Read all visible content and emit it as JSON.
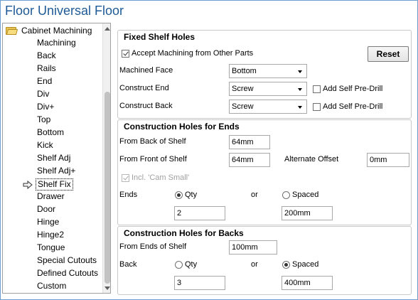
{
  "window": {
    "title": "Floor Universal Floor"
  },
  "tree": {
    "root_label": "Cabinet Machining",
    "items": [
      "Machining",
      "Back",
      "Rails",
      "End",
      "Div",
      "Div+",
      "Top",
      "Bottom",
      "Kick",
      "Shelf Adj",
      "Shelf Adj+",
      "Shelf Fix",
      "Drawer",
      "Door",
      "Hinge",
      "Hinge2",
      "Tongue",
      "Special Cutouts",
      "Defined Cutouts",
      "Custom"
    ],
    "selected": "Shelf Fix"
  },
  "fixed_shelf_holes": {
    "title": "Fixed Shelf Holes",
    "accept_machining_label": "Accept Machining from Other Parts",
    "accept_machining_checked": true,
    "reset_label": "Reset",
    "machined_face_label": "Machined Face",
    "machined_face_value": "Bottom",
    "construct_end_label": "Construct End",
    "construct_end_value": "Screw",
    "construct_back_label": "Construct Back",
    "construct_back_value": "Screw",
    "add_self_predrill_label": "Add Self Pre-Drill",
    "add_self_predrill_end_checked": false,
    "add_self_predrill_back_checked": false
  },
  "holes_for_ends": {
    "title": "Construction Holes for Ends",
    "from_back_label": "From Back of Shelf",
    "from_back_value": "64mm",
    "from_front_label": "From Front of Shelf",
    "from_front_value": "64mm",
    "alternate_offset_label": "Alternate Offset",
    "alternate_offset_value": "0mm",
    "incl_cam_label": "Incl. 'Cam Small'",
    "ends_label": "Ends",
    "qty_label": "Qty",
    "or_label": "or",
    "spaced_label": "Spaced",
    "qty_value": "2",
    "spaced_value": "200mm",
    "selected_mode": "Qty"
  },
  "holes_for_backs": {
    "title": "Construction Holes for Backs",
    "from_ends_label": "From Ends of Shelf",
    "from_ends_value": "100mm",
    "back_label": "Back",
    "qty_label": "Qty",
    "or_label": "or",
    "spaced_label": "Spaced",
    "qty_value": "3",
    "spaced_value": "400mm",
    "selected_mode": "Spaced"
  }
}
